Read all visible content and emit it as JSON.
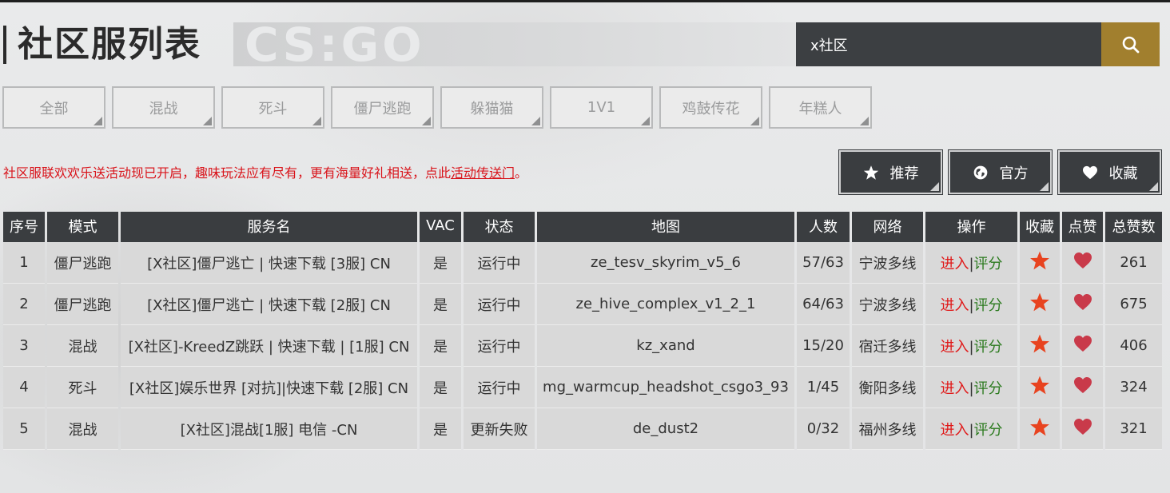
{
  "header": {
    "title": "社区服列表",
    "logo_text": "CS:GO"
  },
  "search": {
    "value": "x社区"
  },
  "tabs": [
    "全部",
    "混战",
    "死斗",
    "僵尸逃跑",
    "躲猫猫",
    "1V1",
    "鸡鼓传花",
    "年糕人"
  ],
  "notice": {
    "text": "社区服联欢欢乐送活动现已开启，趣味玩法应有尽有，更有海量好礼相送，点此",
    "link": "活动传送门",
    "end": "。"
  },
  "actions": {
    "recommend": "推荐",
    "official": "官方",
    "favorites": "收藏"
  },
  "table": {
    "headers": [
      "序号",
      "模式",
      "服务名",
      "VAC",
      "状态",
      "地图",
      "人数",
      "网络",
      "操作",
      "收藏",
      "点赞",
      "总赞数"
    ],
    "enter_label": "进入",
    "sep": "|",
    "rate_label": "评分",
    "rows": [
      {
        "idx": "1",
        "mode": "僵尸逃跑",
        "name": "[X社区]僵尸逃亡 | 快速下载 [3服] CN",
        "vac": "是",
        "status": "运行中",
        "status_ok": true,
        "map": "ze_tesv_skyrim_v5_6",
        "players": "57/63",
        "network": "宁波多线",
        "likes": "261"
      },
      {
        "idx": "2",
        "mode": "僵尸逃跑",
        "name": "[X社区]僵尸逃亡 | 快速下载 [2服] CN",
        "vac": "是",
        "status": "运行中",
        "status_ok": true,
        "map": "ze_hive_complex_v1_2_1",
        "players": "64/63",
        "network": "宁波多线",
        "likes": "675"
      },
      {
        "idx": "3",
        "mode": "混战",
        "name": "[X社区]-KreedZ跳跃 | 快速下载 | [1服] CN",
        "vac": "是",
        "status": "运行中",
        "status_ok": true,
        "map": "kz_xand",
        "players": "15/20",
        "network": "宿迁多线",
        "likes": "406"
      },
      {
        "idx": "4",
        "mode": "死斗",
        "name": "[X社区]娱乐世界 [对抗]|快速下载 [2服] CN",
        "vac": "是",
        "status": "运行中",
        "status_ok": true,
        "map": "mg_warmcup_headshot_csgo3_93",
        "players": "1/45",
        "network": "衡阳多线",
        "likes": "324"
      },
      {
        "idx": "5",
        "mode": "混战",
        "name": "[X社区]混战[1服] 电信 -CN",
        "vac": "是",
        "status": "更新失败",
        "status_ok": false,
        "map": "de_dust2",
        "players": "0/32",
        "network": "福州多线",
        "likes": "321"
      }
    ]
  },
  "colors": {
    "dark": "#3a3d40",
    "gold": "#a17f2e",
    "red": "#e01818",
    "green": "#2b7a1e",
    "star": "#e8431f",
    "heart": "#c93a4a"
  }
}
